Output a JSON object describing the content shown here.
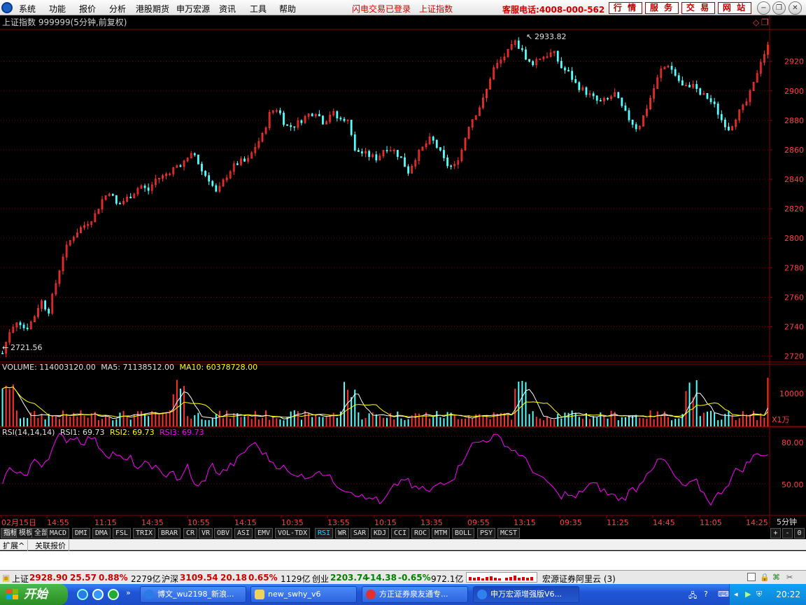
{
  "menubar": {
    "items": [
      "系统",
      "功能",
      "报价",
      "分析",
      "港股期货",
      "申万宏源",
      "资讯",
      "工具",
      "帮助"
    ],
    "notices": [
      "闪电交易已登录",
      "上证指数"
    ],
    "hotline": "客服电话:4008-000-562",
    "buttons": [
      "行 情",
      "服 务",
      "交 易",
      "网 站"
    ]
  },
  "chart_header": {
    "title": "上证指数 999999(5分钟,前复权)",
    "high_label": "2933.82",
    "low_label": "2721.56"
  },
  "volume_header": {
    "volume": "VOLUME: 114003120.00",
    "ma5": "MA5: 71138512.00",
    "ma10": "MA10: 60378728.00",
    "unit": "X1万",
    "tick": "10000"
  },
  "rsi_header": {
    "name": "RSI(14,14,14)",
    "rsi1": "RSI1: 69.73",
    "rsi2": "RSI2: 69.73",
    "rsi3": "RSI3: 69.73",
    "ticks": [
      "80.00",
      "50.00"
    ]
  },
  "time_axis": {
    "labels": [
      "02月15日",
      "14:55",
      "11:15",
      "14:35",
      "10:55",
      "14:15",
      "10:35",
      "13:55",
      "10:15",
      "13:35",
      "09:55",
      "13:15",
      "09:35",
      "11:25",
      "14:45",
      "11:05",
      "14:25"
    ],
    "period": "5分钟"
  },
  "colors": {
    "up": "#ff3232",
    "down": "#54ffff",
    "grid": "#8b0000",
    "ma5": "#ffffff",
    "ma10": "#ffff00",
    "rsi": "#ff00ff"
  },
  "indicator_tabs": [
    "指标",
    "模板",
    "全部",
    "MACD",
    "DMI",
    "DMA",
    "FSL",
    "TRIX",
    "BRAR",
    "CR",
    "VR",
    "OBV",
    "ASI",
    "EMV",
    "VOL-TDX",
    "RSI",
    "WR",
    "SAR",
    "KDJ",
    "CCI",
    "ROC",
    "MTM",
    "BOLL",
    "PSY",
    "MCST"
  ],
  "active_tab": "RSI",
  "tab_controls": [
    "+",
    "-",
    "0"
  ],
  "ext_tabs": [
    "扩展^",
    "关联报价"
  ],
  "statusbar": {
    "sh_label": "上证",
    "sh_value": "2928.90",
    "sh_change": "25.57",
    "sh_pct": "0.88%",
    "sh_amount": "2279亿",
    "hs_label": "沪深",
    "hs_value": "3109.54",
    "hs_change": "20.18",
    "hs_pct": "0.65%",
    "hs_amount": "1129亿",
    "cy_label": "创业",
    "cy_value": "2203.74",
    "cy_change": "-14.38",
    "cy_pct": "-0.65%",
    "cy_amount": "972.1亿",
    "server": "宏源证券阿里云 (3)"
  },
  "taskbar": {
    "start": "开始",
    "items": [
      "博文_wu2198_新浪...",
      "new_swhy_v6",
      "方正证券泉友通专...",
      "申万宏源增强版V6..."
    ],
    "clock": "20:22"
  },
  "chart_data": {
    "type": "candlestick",
    "price_axis": {
      "ticks": [
        2720,
        2740,
        2760,
        2780,
        2800,
        2820,
        2840,
        2860,
        2880,
        2900,
        2920
      ],
      "ylim": [
        2716,
        2936
      ]
    },
    "high": 2933.82,
    "low": 2721.56,
    "close_path": [
      2722,
      2738,
      2745,
      2738,
      2745,
      2758,
      2750,
      2770,
      2790,
      2800,
      2806,
      2810,
      2815,
      2826,
      2832,
      2822,
      2826,
      2830,
      2836,
      2832,
      2840,
      2842,
      2846,
      2850,
      2852,
      2858,
      2846,
      2840,
      2830,
      2840,
      2848,
      2852,
      2852,
      2862,
      2870,
      2886,
      2888,
      2876,
      2876,
      2880,
      2884,
      2886,
      2878,
      2886,
      2880,
      2882,
      2860,
      2858,
      2856,
      2854,
      2862,
      2860,
      2855,
      2845,
      2855,
      2862,
      2868,
      2860,
      2850,
      2848,
      2860,
      2878,
      2886,
      2896,
      2914,
      2920,
      2926,
      2933,
      2926,
      2918,
      2922,
      2924,
      2926,
      2916,
      2912,
      2904,
      2900,
      2896,
      2892,
      2894,
      2898,
      2888,
      2880,
      2874,
      2886,
      2900,
      2914,
      2918,
      2910,
      2902,
      2904,
      2898,
      2896,
      2890,
      2880,
      2874,
      2884,
      2890,
      2902,
      2920,
      2930
    ],
    "rsi_path": [
      52,
      60,
      58,
      54,
      66,
      62,
      70,
      80,
      78,
      80,
      76,
      80,
      74,
      68,
      70,
      64,
      66,
      58,
      64,
      60,
      54,
      60,
      50,
      62,
      46,
      52,
      62,
      56,
      60,
      64,
      70,
      76,
      72,
      66,
      62,
      60,
      54,
      58,
      52,
      60,
      56,
      52,
      48,
      46,
      44,
      40,
      42,
      36,
      44,
      50,
      54,
      46,
      48,
      44,
      50,
      52,
      54,
      64,
      74,
      76,
      78,
      80,
      78,
      72,
      70,
      64,
      58,
      52,
      50,
      42,
      44,
      40,
      46,
      50,
      48,
      44,
      42,
      40,
      46,
      48,
      58,
      62,
      66,
      58,
      50,
      48,
      52,
      44,
      38,
      44,
      50,
      58,
      60,
      66,
      70,
      68
    ]
  }
}
